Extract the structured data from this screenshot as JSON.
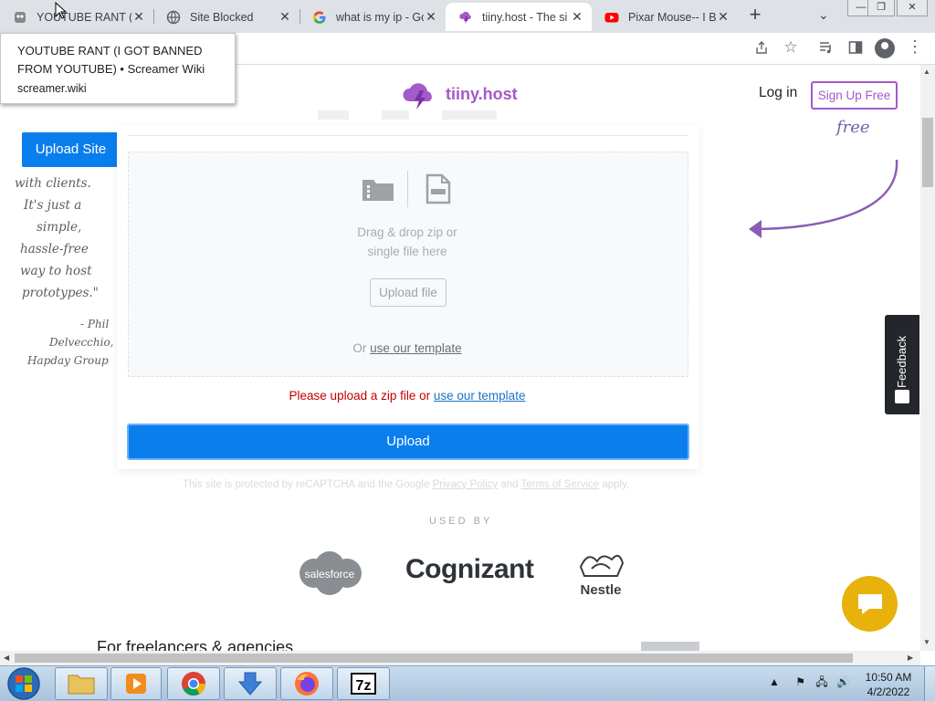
{
  "browser": {
    "tabs": [
      {
        "title": "YOUTUBE RANT (I",
        "icon": "screamer-favicon-icon"
      },
      {
        "title": "Site Blocked",
        "icon": "globe-icon"
      },
      {
        "title": "what is my ip - Go",
        "icon": "google-icon"
      },
      {
        "title": "tiiny.host - The si",
        "icon": "tiiny-host-icon",
        "active": true
      },
      {
        "title": "Pixar Mouse-- I B",
        "icon": "youtube-icon"
      }
    ],
    "new_tab": "+",
    "window_controls": [
      "—",
      "❐",
      "✕"
    ]
  },
  "tooltip": {
    "title": "YOUTUBE RANT (I GOT BANNED FROM YOUTUBE) • Screamer Wiki",
    "url": "screamer.wiki"
  },
  "header": {
    "logo_text": "tiiny.host",
    "login": "Log in",
    "signup": "Sign Up Free"
  },
  "sidebar": {
    "upload_site": "Upload Site"
  },
  "testimonial": {
    "lines": [
      "with clients.",
      "It's just a",
      "simple,",
      "hassle-free",
      "way to host",
      "prototypes.\""
    ],
    "author_lines": [
      "- Phil",
      "Delvecchio,",
      "Hapday Group"
    ]
  },
  "aside_note": "free",
  "upload_card": {
    "drop_text_1": "Drag & drop zip or",
    "drop_text_2": "single file here",
    "upload_file": "Upload file",
    "or_text": "Or ",
    "template_link": "use our template",
    "error_text": "Please upload a zip file or ",
    "error_link": "use our template",
    "upload_button": "Upload"
  },
  "recaptcha_pre": "This site is protected by reCAPTCHA and the Google ",
  "privacy_link": "Privacy Policy",
  "recaptcha_mid": " and ",
  "terms_link": "Terms of Service",
  "recaptcha_post": " apply.",
  "used_by": {
    "label": "USED BY",
    "logos": [
      "salesforce",
      "Cognizant",
      "Nestle"
    ]
  },
  "footer_partial": "For freelancers & agencies",
  "feedback": "Feedback",
  "taskbar": {
    "time": "10:50 AM",
    "date": "4/2/2022"
  }
}
